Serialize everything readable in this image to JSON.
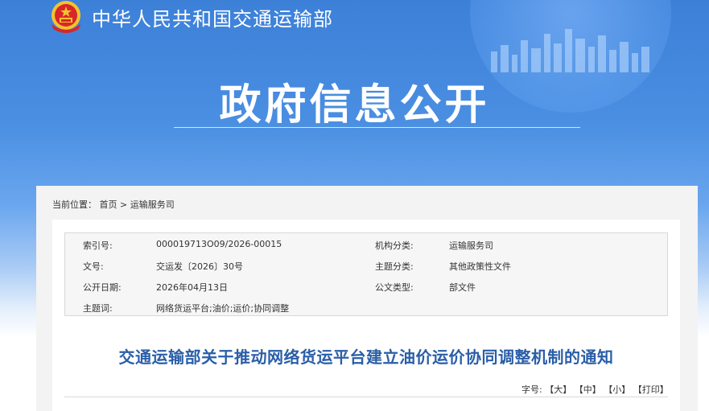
{
  "header": {
    "ministry_name": "中华人民共和国交通运输部",
    "hero_title": "政府信息公开"
  },
  "breadcrumb": {
    "prefix": "当前位置：",
    "home": "首页",
    "separator": ">",
    "current": "运输服务司"
  },
  "meta": {
    "index_label": "索引号:",
    "index_value": "000019713O09/2026-00015",
    "org_label": "机构分类:",
    "org_value": "运输服务司",
    "docno_label": "文号:",
    "docno_value": "交运发〔2026〕30号",
    "topic_label": "主题分类:",
    "topic_value": "其他政策性文件",
    "date_label": "公开日期:",
    "date_value": "2026年04月13日",
    "type_label": "公文类型:",
    "type_value": "部文件",
    "keywords_label": "主题词:",
    "keywords_value": "网络货运平台;油价;运价;协同调整"
  },
  "document": {
    "title": "交通运输部关于推动网络货运平台建立油价运价协同调整机制的通知"
  },
  "font_controls": {
    "label": "字号:",
    "large": "【大】",
    "medium": "【中】",
    "small": "【小】",
    "print": "【打印】"
  },
  "colors": {
    "banner_blue": "#3c80d8",
    "title_blue": "#2a5ea8",
    "emblem_red": "#d8262a",
    "emblem_gold": "#f3c32e"
  }
}
